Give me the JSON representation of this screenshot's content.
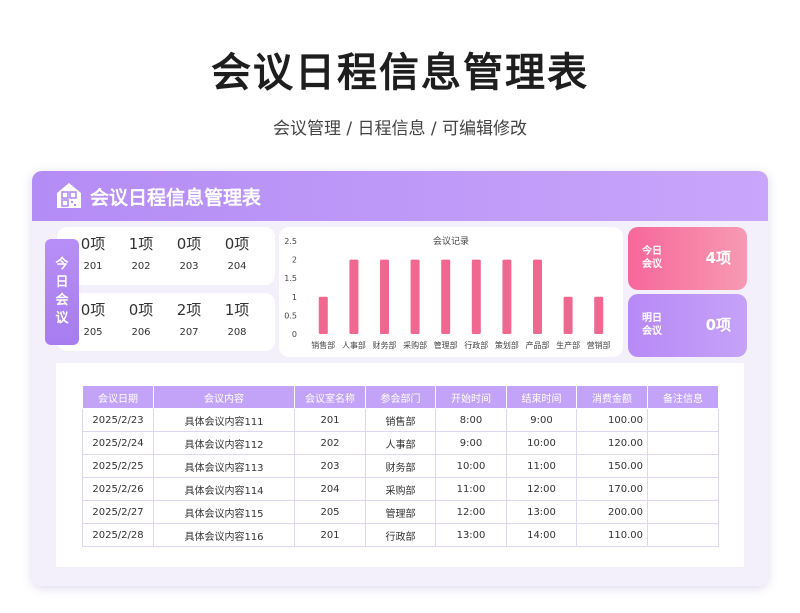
{
  "page": {
    "title": "会议日程信息管理表",
    "subtitle": "会议管理 / 日程信息 /  可编辑修改"
  },
  "card": {
    "title": "会议日程信息管理表",
    "logo_icon": "building-qr-icon"
  },
  "today_panel": {
    "label_chars": [
      "今",
      "日",
      "会",
      "议"
    ],
    "rooms": [
      {
        "count": "0项",
        "room": "201"
      },
      {
        "count": "1项",
        "room": "202"
      },
      {
        "count": "0项",
        "room": "203"
      },
      {
        "count": "0项",
        "room": "204"
      },
      {
        "count": "0项",
        "room": "205"
      },
      {
        "count": "0项",
        "room": "206"
      },
      {
        "count": "2项",
        "room": "207"
      },
      {
        "count": "1项",
        "room": "208"
      }
    ]
  },
  "chart_data": {
    "type": "bar",
    "title": "会议记录",
    "categories": [
      "销售部",
      "人事部",
      "财务部",
      "采购部",
      "管理部",
      "行政部",
      "策划部",
      "产品部",
      "生产部",
      "营销部"
    ],
    "values": [
      1,
      2,
      2,
      2,
      2,
      2,
      2,
      2,
      1,
      1
    ],
    "ylim": [
      0,
      2.5
    ],
    "yticks": [
      "2.5",
      "2",
      "1.5",
      "1",
      "0.5",
      "0"
    ],
    "bar_color": "#f0678f",
    "grid": false
  },
  "stats": {
    "today": {
      "label": "今日会议",
      "value": "4项",
      "color": "#f7679a"
    },
    "tomorrow": {
      "label": "明日会议",
      "value": "0项",
      "color": "#b889f6"
    }
  },
  "table": {
    "headers": [
      "会议日期",
      "会议内容",
      "会议室名称",
      "参会部门",
      "开始时间",
      "结束时间",
      "消费金额",
      "备注信息"
    ],
    "rows": [
      [
        "2025/2/23",
        "具体会议内容111",
        "201",
        "销售部",
        "8:00",
        "9:00",
        "100.00",
        ""
      ],
      [
        "2025/2/24",
        "具体会议内容112",
        "202",
        "人事部",
        "9:00",
        "10:00",
        "120.00",
        ""
      ],
      [
        "2025/2/25",
        "具体会议内容113",
        "203",
        "财务部",
        "10:00",
        "11:00",
        "150.00",
        ""
      ],
      [
        "2025/2/26",
        "具体会议内容114",
        "204",
        "采购部",
        "11:00",
        "12:00",
        "170.00",
        ""
      ],
      [
        "2025/2/27",
        "具体会议内容115",
        "205",
        "管理部",
        "12:00",
        "13:00",
        "200.00",
        ""
      ],
      [
        "2025/2/28",
        "具体会议内容116",
        "201",
        "行政部",
        "13:00",
        "14:00",
        "110.00",
        ""
      ]
    ]
  },
  "colors": {
    "header_purple": "#b48cf5",
    "accent_pink": "#f7679a",
    "table_header": "#c2a3f8"
  }
}
